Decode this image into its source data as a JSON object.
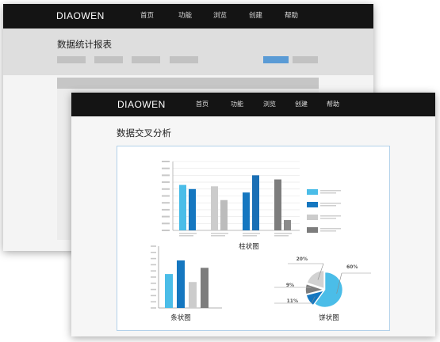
{
  "back_window": {
    "logo": "DIAOWEN",
    "menu": [
      "首页",
      "功能",
      "浏览",
      "创建",
      "帮助"
    ],
    "page_title": "数据统计报表"
  },
  "front_window": {
    "logo": "DIAOWEN",
    "menu": [
      "首页",
      "功能",
      "浏览",
      "创建",
      "帮助"
    ],
    "page_title": "数据交叉分析",
    "captions": {
      "column": "柱状图",
      "bar": "条状图",
      "pie": "饼状图"
    }
  },
  "colors": {
    "light_blue": "#4bbde8",
    "blue": "#1577c0",
    "light_gray": "#cccccc",
    "gray": "#7d7d7d",
    "nav": "#141414",
    "frame_border": "#b3d1ea"
  },
  "chart_data": [
    {
      "type": "bar",
      "name": "柱状图",
      "categories": [
        "",
        "",
        "",
        ""
      ],
      "series": [
        {
          "values": [
            66,
            64,
            55,
            74
          ]
        },
        {
          "values": [
            60,
            44,
            80,
            15
          ]
        }
      ],
      "series_colors": [
        [
          "#4bbde8",
          "#1577c0"
        ],
        [
          "#cccccc",
          "#bcbcbc"
        ],
        [
          "#1577c0",
          "#1a6fb5"
        ],
        [
          "#7d7d7d",
          "#8a8a8a"
        ]
      ],
      "ylim": [
        0,
        100
      ],
      "legend": "right",
      "grid": true
    },
    {
      "type": "bar",
      "name": "条状图",
      "values": [
        55,
        77,
        42,
        65
      ],
      "colors": [
        "#4bbde8",
        "#1577c0",
        "#cccccc",
        "#7d7d7d"
      ],
      "ylim": [
        0,
        100
      ]
    },
    {
      "type": "pie",
      "name": "饼状图",
      "slices": [
        {
          "label": "60%",
          "value": 60,
          "color": "#4bbde8"
        },
        {
          "label": "11%",
          "value": 11,
          "color": "#1577c0"
        },
        {
          "label": "9%",
          "value": 9,
          "color": "#7d7d7d"
        },
        {
          "label": "20%",
          "value": 20,
          "color": "#d2d2d2"
        }
      ]
    }
  ]
}
